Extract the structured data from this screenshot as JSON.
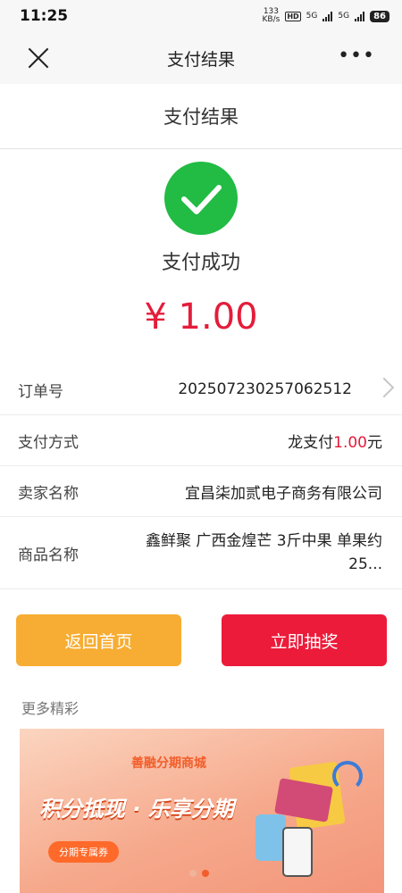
{
  "status_bar": {
    "time": "11:25",
    "network_speed": "133\nKB/s",
    "hd_label": "HD",
    "signal1_label": "5G",
    "signal2_label": "5G",
    "battery": "86"
  },
  "nav": {
    "title": "支付结果",
    "close_icon": "close-icon",
    "more_icon": "more-icon"
  },
  "subheader": {
    "title": "支付结果"
  },
  "result": {
    "status_text": "支付成功",
    "amount": "¥ 1.00",
    "icon": "check-icon",
    "accent": "#22bb44",
    "amount_color": "#e41c3a"
  },
  "details": {
    "order_label": "订单号",
    "order_value": "20250723025706251​2",
    "payment_label": "支付方式",
    "payment_method": "龙支付",
    "payment_amount": "1.00",
    "payment_unit": "元",
    "seller_label": "卖家名称",
    "seller_value": "宜昌柒加贰电子商务有限公司",
    "product_label": "商品名称",
    "product_value": "鑫鲜聚 广西金煌芒 3斤中果 单果约25..."
  },
  "buttons": {
    "home": "返回首页",
    "draw": "立即抽奖"
  },
  "more": {
    "title": "更多精彩"
  },
  "banner": {
    "mall_title": "善融分期商城",
    "slogan": "积分抵现 · 乐享分期",
    "coupon": "分期专属券"
  }
}
